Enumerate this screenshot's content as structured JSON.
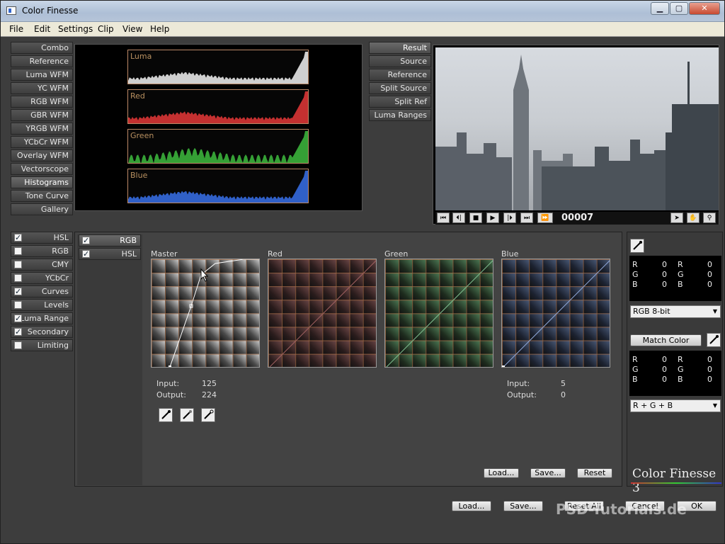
{
  "window": {
    "title": "Color Finesse",
    "controls": {
      "minimize": "▁",
      "maximize": "▢",
      "close": "✕"
    }
  },
  "menu": [
    "File",
    "Edit",
    "Settings",
    "Clip",
    "View",
    "Help"
  ],
  "scopes": {
    "items": [
      "Combo",
      "Reference",
      "Luma WFM",
      "YC WFM",
      "RGB WFM",
      "GBR WFM",
      "YRGB WFM",
      "YCbCr WFM",
      "Overlay WFM",
      "Vectorscope",
      "Histograms",
      "Tone Curve",
      "Gallery"
    ],
    "active": "Histograms"
  },
  "histograms": [
    "Luma",
    "Red",
    "Green",
    "Blue"
  ],
  "histogram_colors": [
    "#cfcfcf",
    "#c43030",
    "#35a035",
    "#3060c8"
  ],
  "viewer_tabs": [
    "Result",
    "Source",
    "Reference",
    "Split Source",
    "Split Ref",
    "Luma Ranges"
  ],
  "transport": {
    "buttons": [
      "⏮",
      "⏴|",
      "■",
      "▶",
      "|⏵",
      "⏭",
      "⏩"
    ],
    "frame": "00007"
  },
  "corrections": [
    {
      "label": "HSL",
      "checked": true
    },
    {
      "label": "RGB",
      "checked": false
    },
    {
      "label": "CMY",
      "checked": false
    },
    {
      "label": "YCbCr",
      "checked": false
    },
    {
      "label": "Curves",
      "checked": true
    },
    {
      "label": "Levels",
      "checked": false
    },
    {
      "label": "Luma Range",
      "checked": true
    },
    {
      "label": "Secondary",
      "checked": true
    },
    {
      "label": "Limiting",
      "checked": false
    }
  ],
  "curve_tabs": [
    {
      "label": "RGB",
      "checked": true
    },
    {
      "label": "HSL",
      "checked": true
    }
  ],
  "curves": [
    "Master",
    "Red",
    "Green",
    "Blue"
  ],
  "master_io": {
    "input_label": "Input:",
    "input": "125",
    "output_label": "Output:",
    "output": "224"
  },
  "blue_io": {
    "input_label": "Input:",
    "input": "5",
    "output_label": "Output:",
    "output": "0"
  },
  "curve_buttons": {
    "load": "Load...",
    "save": "Save...",
    "reset": "Reset"
  },
  "readout1": {
    "rows": [
      [
        "R",
        "0",
        "R",
        "0"
      ],
      [
        "G",
        "0",
        "G",
        "0"
      ],
      [
        "B",
        "0",
        "B",
        "0"
      ]
    ]
  },
  "readout2": {
    "rows": [
      [
        "R",
        "0",
        "R",
        "0"
      ],
      [
        "G",
        "0",
        "G",
        "0"
      ],
      [
        "B",
        "0",
        "B",
        "0"
      ]
    ]
  },
  "bit_depth": "RGB 8-bit",
  "match_color": "Match Color",
  "match_mode": "R + G + B",
  "brand": "Color Finesse 3",
  "watermark": "PSD-Tutorials.de",
  "bottom_buttons": {
    "load": "Load...",
    "save": "Save...",
    "reset_all": "Reset All",
    "cancel": "Cancel",
    "ok": "OK"
  }
}
